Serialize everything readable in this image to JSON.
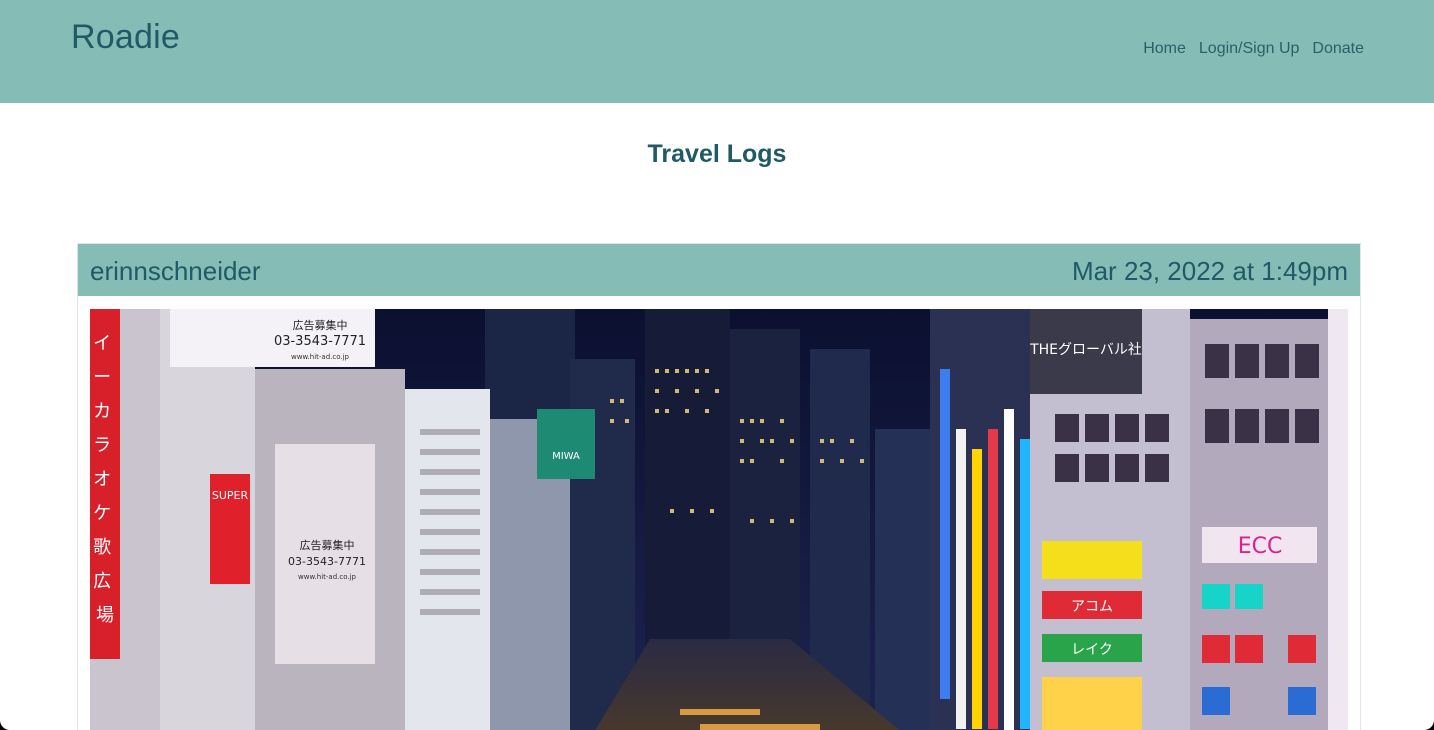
{
  "header": {
    "brand": "Roadie",
    "nav": [
      {
        "label": "Home"
      },
      {
        "label": "Login/Sign Up"
      },
      {
        "label": "Donate"
      }
    ]
  },
  "main": {
    "title": "Travel Logs",
    "posts": [
      {
        "username": "erinnschneider",
        "timestamp": "Mar 23, 2022 at 1:49pm",
        "image_signs": {
          "ad_top_left_text": "広告募集中",
          "ad_top_left_phone": "03-3543-7771",
          "ad_top_left_url": "www.hit-ad.co.jp",
          "ad_mid_left_text": "広告募集中",
          "ad_mid_left_phone": "03-3543-7771",
          "ad_mid_left_url": "www.hit-ad.co.jp",
          "vertical_karaoke": "イーカラオケ歌広場",
          "super_sign": "SUPER",
          "green_sign": "MIWA",
          "the_global_sign": "THEグローバル社",
          "acom_sign": "アコム",
          "lake_sign": "レイク",
          "ecc_sign": "ECC"
        }
      }
    ]
  },
  "colors": {
    "header_bg": "#86bcb6",
    "text_primary": "#1f5a66",
    "page_bg": "#ffffff"
  }
}
